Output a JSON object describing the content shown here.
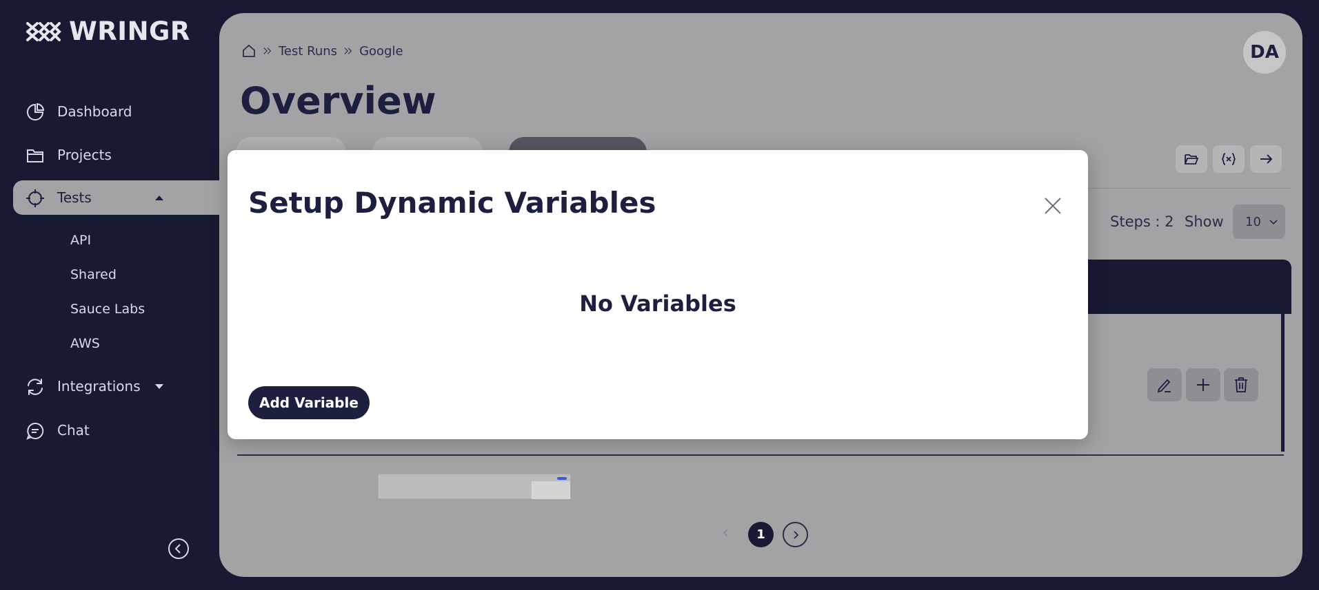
{
  "app": {
    "name": "WRINGR"
  },
  "sidebar": {
    "items": [
      {
        "label": "Dashboard",
        "icon": "pie-chart-icon"
      },
      {
        "label": "Projects",
        "icon": "folder-icon"
      },
      {
        "label": "Tests",
        "icon": "crosshair-icon",
        "active": true,
        "expanded": true
      },
      {
        "label": "Integrations",
        "icon": "refresh-icon",
        "expanded": false
      },
      {
        "label": "Chat",
        "icon": "chat-icon"
      }
    ],
    "test_subitems": [
      "API",
      "Shared",
      "Sauce Labs",
      "AWS"
    ]
  },
  "header": {
    "breadcrumb": [
      "Test Runs",
      "Google"
    ],
    "avatar_initials": "DA",
    "title": "Overview"
  },
  "toolbar": {
    "icons": [
      "folder-open-icon",
      "variables-icon",
      "arrow-right-icon"
    ]
  },
  "steps": {
    "steps_label": "Steps : 2",
    "show_label": "Show",
    "page_size": "10"
  },
  "pagination": {
    "current_page": "1"
  },
  "modal": {
    "title": "Setup Dynamic Variables",
    "empty_message": "No Variables",
    "add_button_label": "Add Variable"
  },
  "colors": {
    "sidebar_bg": "#181a33",
    "main_bg": "#a3a3a6",
    "accent": "#1d1f3f",
    "modal_bg": "#ffffff"
  }
}
